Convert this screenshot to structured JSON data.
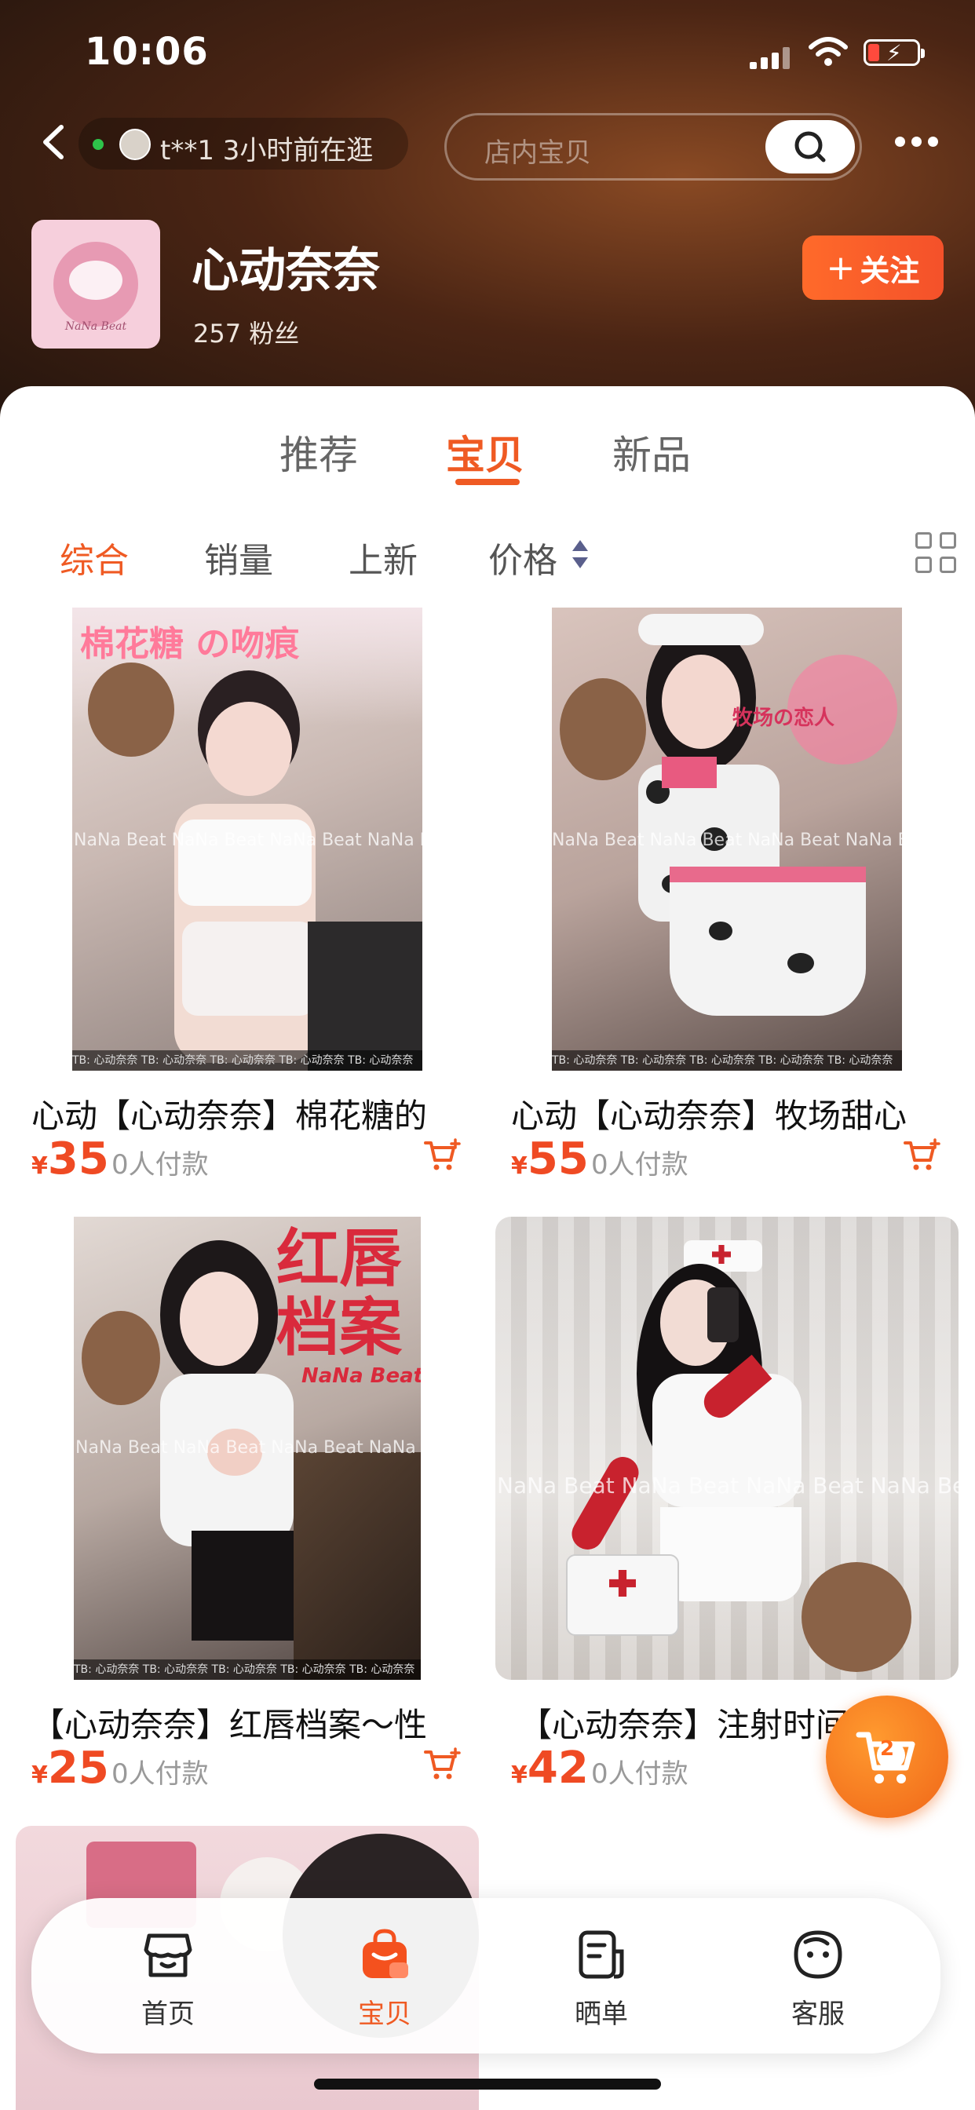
{
  "status_bar": {
    "time": "10:06"
  },
  "header": {
    "visitor_text": "t**1 3小时前在逛",
    "search_placeholder": "店内宝贝",
    "shop_name": "心动奈奈",
    "fans": "257 粉丝",
    "follow_label": "关注",
    "logo_text": "NaNa Beat"
  },
  "tabs": [
    {
      "label": "推荐",
      "active": false
    },
    {
      "label": "宝贝",
      "active": true
    },
    {
      "label": "新品",
      "active": false
    }
  ],
  "sort": [
    {
      "label": "综合",
      "active": true
    },
    {
      "label": "销量",
      "active": false
    },
    {
      "label": "上新",
      "active": false
    },
    {
      "label": "价格",
      "active": false
    }
  ],
  "products": [
    {
      "title": "心动【心动奈奈】棉花糖的",
      "currency": "¥",
      "price": "35",
      "paid": "0人付款",
      "overlay_text": "棉花糖  の吻痕",
      "watermark": "NaNa Beat NaNa Beat NaNa Beat NaNa Beat",
      "strip": "TB: 心动奈奈 TB: 心动奈奈 TB: 心动奈奈 TB: 心动奈奈 TB: 心动奈奈"
    },
    {
      "title": "心动【心动奈奈】牧场甜心",
      "currency": "¥",
      "price": "55",
      "paid": "0人付款",
      "overlay_text": "牧场の恋人",
      "watermark": "NaNa Beat NaNa Beat NaNa Beat NaNa Beat",
      "strip": "TB: 心动奈奈 TB: 心动奈奈 TB: 心动奈奈 TB: 心动奈奈 TB: 心动奈奈"
    },
    {
      "title": "【心动奈奈】红唇档案～性",
      "currency": "¥",
      "price": "25",
      "paid": "0人付款",
      "overlay_text": "红唇\n档案",
      "overlay_sub": "NaNa Beat",
      "watermark": "NaNa Beat NaNa Beat NaNa Beat NaNa Beat",
      "strip": "TB: 心动奈奈 TB: 心动奈奈 TB: 心动奈奈 TB: 心动奈奈 TB: 心动奈奈"
    },
    {
      "title": "【心动奈奈】注射时间",
      "currency": "¥",
      "price": "42",
      "paid": "0人付款",
      "watermark": "NaNa Beat NaNa Beat NaNa Beat NaNa Beat"
    }
  ],
  "cart": {
    "count": "2"
  },
  "bottom_nav": [
    {
      "label": "首页",
      "icon": "shop-icon",
      "active": false
    },
    {
      "label": "宝贝",
      "icon": "bag-icon",
      "active": true
    },
    {
      "label": "晒单",
      "icon": "note-icon",
      "active": false
    },
    {
      "label": "客服",
      "icon": "service-icon",
      "active": false
    }
  ],
  "colors": {
    "accent": "#ef5a23",
    "price": "#ef4a23",
    "header_bg": "#4b2514"
  }
}
